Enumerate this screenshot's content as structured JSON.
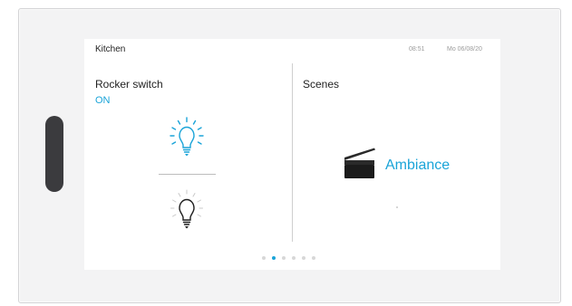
{
  "header": {
    "room": "Kitchen",
    "time": "08:51",
    "date": "Mo 06/08/20"
  },
  "rocker": {
    "title": "Rocker switch",
    "state": "ON",
    "on_icon": "lightbulb-on-icon",
    "off_icon": "lightbulb-off-icon"
  },
  "scenes": {
    "title": "Scenes",
    "icon": "piano-icon",
    "label": "Ambiance"
  },
  "pager": {
    "pages": 6,
    "active_index": 1
  },
  "colors": {
    "accent": "#1aa4d8",
    "text": "#222222",
    "frame": "#f3f3f4"
  }
}
